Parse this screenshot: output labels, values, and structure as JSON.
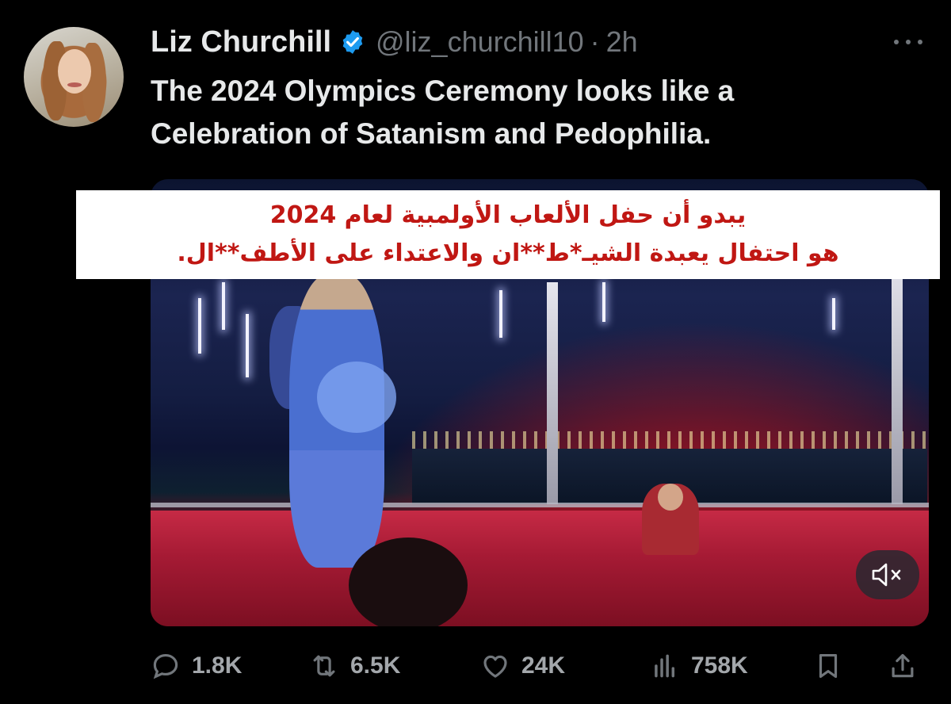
{
  "tweet": {
    "author_name": "Liz Churchill",
    "handle": "@liz_churchill10",
    "separator": "·",
    "time": "2h",
    "text_lines": [
      "The 2024 Olympics Ceremony looks like a",
      "Celebration of Satanism and Pedophilia."
    ]
  },
  "overlay": {
    "line1": "يبدو أن حفل الألعاب الأولمبية لعام 2024",
    "line2": "هو احتفال يعبدة الشيـ*ط**ان  والاعتداء على الأطف**ال."
  },
  "actions": {
    "replies": "1.8K",
    "reposts": "6.5K",
    "likes": "24K",
    "views": "758K"
  },
  "colors": {
    "background": "#000000",
    "text": "#e7e9ea",
    "muted": "#71767b",
    "verified": "#1d9bf0",
    "overlay_text": "#c01713"
  },
  "icons": [
    "verified-badge-icon",
    "more-icon",
    "mute-icon",
    "reply-icon",
    "repost-icon",
    "like-icon",
    "views-icon",
    "bookmark-icon",
    "share-icon"
  ]
}
